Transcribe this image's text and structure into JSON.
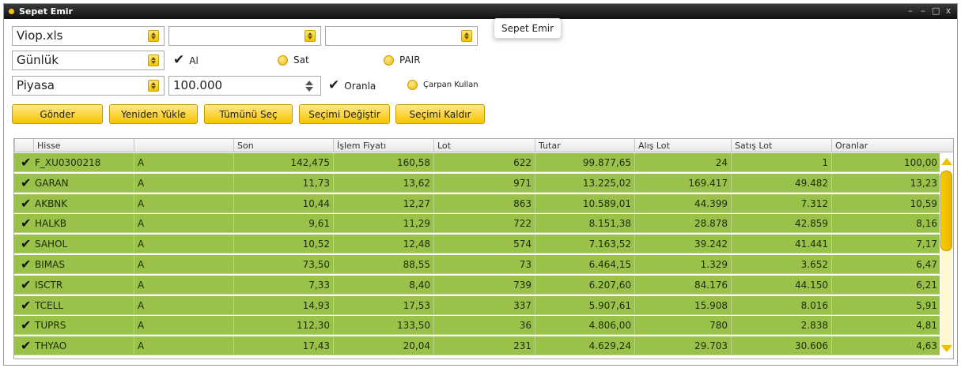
{
  "window": {
    "title": "Sepet Emir",
    "controls": [
      "–",
      "–",
      "□",
      "x"
    ]
  },
  "tooltip": "Sepet Emir",
  "row1": {
    "file_combo": "Viop.xls",
    "combo2": "",
    "combo3": ""
  },
  "row2": {
    "period_combo": "Günlük",
    "al_label": "Al",
    "sat_label": "Sat",
    "pair_label": "PAIR"
  },
  "row3": {
    "price_combo": "Piyasa",
    "amount_value": "100.000",
    "oranla_label": "Oranla",
    "carpan_label": "Çarpan Kullan"
  },
  "buttons": {
    "gonder": "Gönder",
    "yeniden": "Yeniden Yükle",
    "tumunu": "Tümünü Seç",
    "degistir": "Seçimi Değiştir",
    "kaldir": "Seçimi Kaldır"
  },
  "table": {
    "headers": [
      "Hisse",
      "",
      "Son",
      "İşlem Fiyatı",
      "Lot",
      "Tutar",
      "Alış Lot",
      "Satış Lot",
      "Oranlar"
    ],
    "rows": [
      [
        "F_XU0300218",
        "A",
        "142,475",
        "160,58",
        "622",
        "99.877,65",
        "24",
        "1",
        "100,00"
      ],
      [
        "GARAN",
        "A",
        "11,73",
        "13,62",
        "971",
        "13.225,02",
        "169.417",
        "49.482",
        "13,23"
      ],
      [
        "AKBNK",
        "A",
        "10,44",
        "12,27",
        "863",
        "10.589,01",
        "44.399",
        "7.312",
        "10,59"
      ],
      [
        "HALKB",
        "A",
        "9,61",
        "11,29",
        "722",
        "8.151,38",
        "28.878",
        "42.859",
        "8,16"
      ],
      [
        "SAHOL",
        "A",
        "10,52",
        "12,48",
        "574",
        "7.163,52",
        "39.242",
        "41.441",
        "7,17"
      ],
      [
        "BIMAS",
        "A",
        "73,50",
        "88,55",
        "73",
        "6.464,15",
        "1.329",
        "3.652",
        "6,47"
      ],
      [
        "ISCTR",
        "A",
        "7,33",
        "8,40",
        "739",
        "6.207,60",
        "84.176",
        "44.150",
        "6,21"
      ],
      [
        "TCELL",
        "A",
        "14,93",
        "17,53",
        "337",
        "5.907,61",
        "15.908",
        "8.016",
        "5,91"
      ],
      [
        "TUPRS",
        "A",
        "112,30",
        "133,50",
        "36",
        "4.806,00",
        "780",
        "2.838",
        "4,81"
      ],
      [
        "THYAO",
        "A",
        "17,43",
        "20,04",
        "231",
        "4.629,24",
        "29.703",
        "30.606",
        "4,63"
      ]
    ]
  },
  "colors": {
    "row_green": "#9ac24a",
    "accent_yellow": "#f6c400",
    "title_bar": "#1a1a1a"
  }
}
